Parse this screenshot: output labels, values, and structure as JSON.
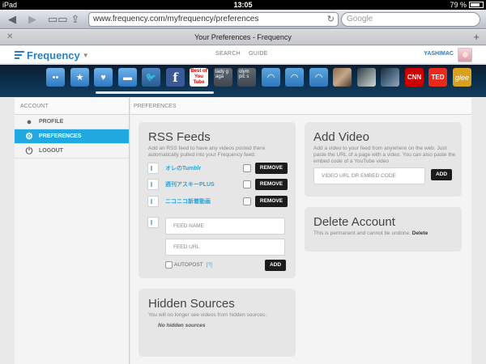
{
  "status_bar": {
    "device": "iPad",
    "time": "13:05",
    "battery_text": "79 %",
    "battery_level": 0.79
  },
  "browser": {
    "url": "www.frequency.com/myfrequency/preferences",
    "search_placeholder": "Google",
    "page_title": "Your Preferences - Frequency"
  },
  "app_header": {
    "logo_text": "Frequency",
    "nav": [
      "SEARCH",
      "GUIDE"
    ],
    "username": "YASHIMAC"
  },
  "channels": [
    {
      "kind": "blue",
      "label": "••"
    },
    {
      "kind": "blue",
      "label": "★"
    },
    {
      "kind": "blue",
      "label": "♥"
    },
    {
      "kind": "blue",
      "label": "▬"
    },
    {
      "kind": "tw",
      "label": "🐦"
    },
    {
      "kind": "fb",
      "label": "f"
    },
    {
      "kind": "yt",
      "label": "Best of You Tube"
    },
    {
      "kind": "text",
      "label": "lady g aga"
    },
    {
      "kind": "text",
      "label": "olym pic s"
    },
    {
      "kind": "rss",
      "label": "◠"
    },
    {
      "kind": "rss",
      "label": "◠"
    },
    {
      "kind": "rss",
      "label": "◠"
    },
    {
      "kind": "thumb1",
      "label": ""
    },
    {
      "kind": "thumb2",
      "label": ""
    },
    {
      "kind": "thumb3",
      "label": ""
    },
    {
      "kind": "cnn",
      "label": "CNN"
    },
    {
      "kind": "ted",
      "label": "TED"
    },
    {
      "kind": "glee",
      "label": "glee"
    }
  ],
  "sidebar": {
    "header": "ACCOUNT",
    "items": [
      {
        "label": "PROFILE",
        "icon": "person-icon"
      },
      {
        "label": "PREFERENCES",
        "icon": "gear-icon"
      },
      {
        "label": "LOGOUT",
        "icon": "power-icon"
      }
    ]
  },
  "main": {
    "header": "PREFERENCES",
    "rss": {
      "title": "RSS Feeds",
      "description": "Add an RSS feed to have any videos posted there automatically pulled into your Frequency feed.",
      "feeds": [
        {
          "name": "オレのTumblr",
          "remove_label": "REMOVE"
        },
        {
          "name": "週刊アスキーPLUS",
          "remove_label": "REMOVE"
        },
        {
          "name": "ニコニコ新着動画",
          "remove_label": "REMOVE"
        }
      ],
      "feed_name_placeholder": "FEED NAME",
      "feed_url_placeholder": "FEED URL",
      "autopost_label": "AUTOPOST",
      "help_label": "[?]",
      "add_label": "ADD"
    },
    "add_video": {
      "title": "Add Video",
      "description": "Add a video to your feed from anywhere on the web. Just paste the URL of a page with a video. You can also paste the embed code of a YouTube video",
      "input_placeholder": "VIDEO URL OR EMBED CODE",
      "add_label": "ADD"
    },
    "delete_account": {
      "title": "Delete Account",
      "description": "This is permanent and cannot be undone.",
      "link_label": "Delete"
    },
    "hidden_sources": {
      "title": "Hidden Sources",
      "description": "You will no longer see videos from hidden sources.",
      "empty_text": "No hidden sources"
    }
  }
}
